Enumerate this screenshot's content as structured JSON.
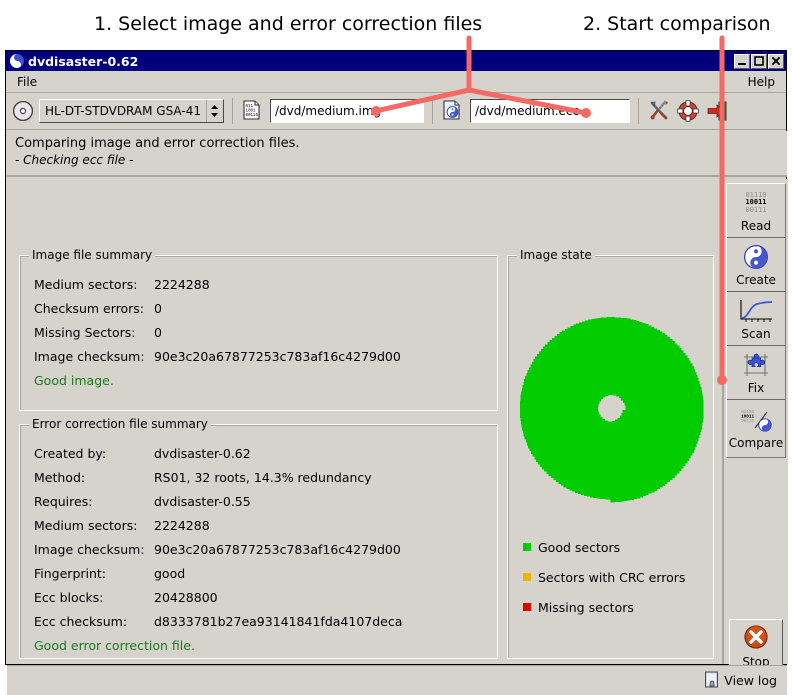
{
  "annotations": {
    "step1": "1. Select image and error correction files",
    "step2": "2. Start comparison",
    "line_color": "#f26a63"
  },
  "window": {
    "title": "dvdisaster-0.62",
    "title_icon": "yinyang-icon",
    "titlebar_color": "#00007f",
    "buttons": {
      "minimize": "_",
      "maximize": "□",
      "close": "✕"
    }
  },
  "menubar": {
    "file": "File",
    "help": "Help"
  },
  "toolbar": {
    "drive_icon": "cd-disc-icon",
    "drive_value": "HL-DT-STDVDRAM GSA-41",
    "image_icon": "binary-file-icon",
    "image_path": "/dvd/medium.img",
    "image_placeholder": "/dvd/medium.img",
    "ecc_icon": "ecc-file-icon",
    "ecc_path": "/dvd/medium.ecc",
    "ecc_placeholder": "/dvd/medium.ecc",
    "prefs_icon": "tools-icon",
    "help_icon": "lifebuoy-icon",
    "quit_icon": "exit-icon"
  },
  "status": {
    "headline": "Comparing image and error correction files.",
    "substatus": "- Checking ecc file -"
  },
  "image_summary": {
    "title": "Image file summary",
    "rows": [
      {
        "label": "Medium sectors:",
        "value": "2224288"
      },
      {
        "label": "Checksum errors:",
        "value": "0"
      },
      {
        "label": "Missing Sectors:",
        "value": "0"
      },
      {
        "label": "Image checksum:",
        "value": "90e3c20a67877253c783af16c4279d00"
      }
    ],
    "verdict": "Good image.",
    "verdict_color": "#1e7a1e"
  },
  "ecc_summary": {
    "title": "Error correction file summary",
    "rows": [
      {
        "label": "Created by:",
        "value": "dvdisaster-0.62"
      },
      {
        "label": "Method:",
        "value": "RS01, 32 roots, 14.3% redundancy"
      },
      {
        "label": "Requires:",
        "value": "dvdisaster-0.55"
      },
      {
        "label": "Medium sectors:",
        "value": "2224288"
      },
      {
        "label": "Image checksum:",
        "value": "90e3c20a67877253c783af16c4279d00"
      },
      {
        "label": "Fingerprint:",
        "value": "good"
      },
      {
        "label": "Ecc blocks:",
        "value": "20428800"
      },
      {
        "label": "Ecc checksum:",
        "value": "d8333781b27ea93141841fda4107deca"
      }
    ],
    "verdict": "Good error correction file.",
    "verdict_color": "#1e7a1e"
  },
  "image_state": {
    "title": "Image state",
    "disc_fill_color": "#00cc00",
    "legend": [
      {
        "color": "#00cc00",
        "label": "Good sectors"
      },
      {
        "color": "#f0b400",
        "label": "Sectors with CRC errors"
      },
      {
        "color": "#e00000",
        "label": "Missing sectors"
      }
    ]
  },
  "sidebar": {
    "actions": [
      {
        "icon": "binary-read-icon",
        "label": "Read"
      },
      {
        "icon": "yinyang-create-icon",
        "label": "Create"
      },
      {
        "icon": "curve-scan-icon",
        "label": "Scan"
      },
      {
        "icon": "puzzle-fix-icon",
        "label": "Fix"
      },
      {
        "icon": "compare-icon",
        "label": "Compare"
      }
    ],
    "stop": {
      "icon": "stop-x-icon",
      "label": "Stop"
    }
  },
  "bottom": {
    "view_log_icon": "log-icon",
    "view_log": "View log"
  }
}
